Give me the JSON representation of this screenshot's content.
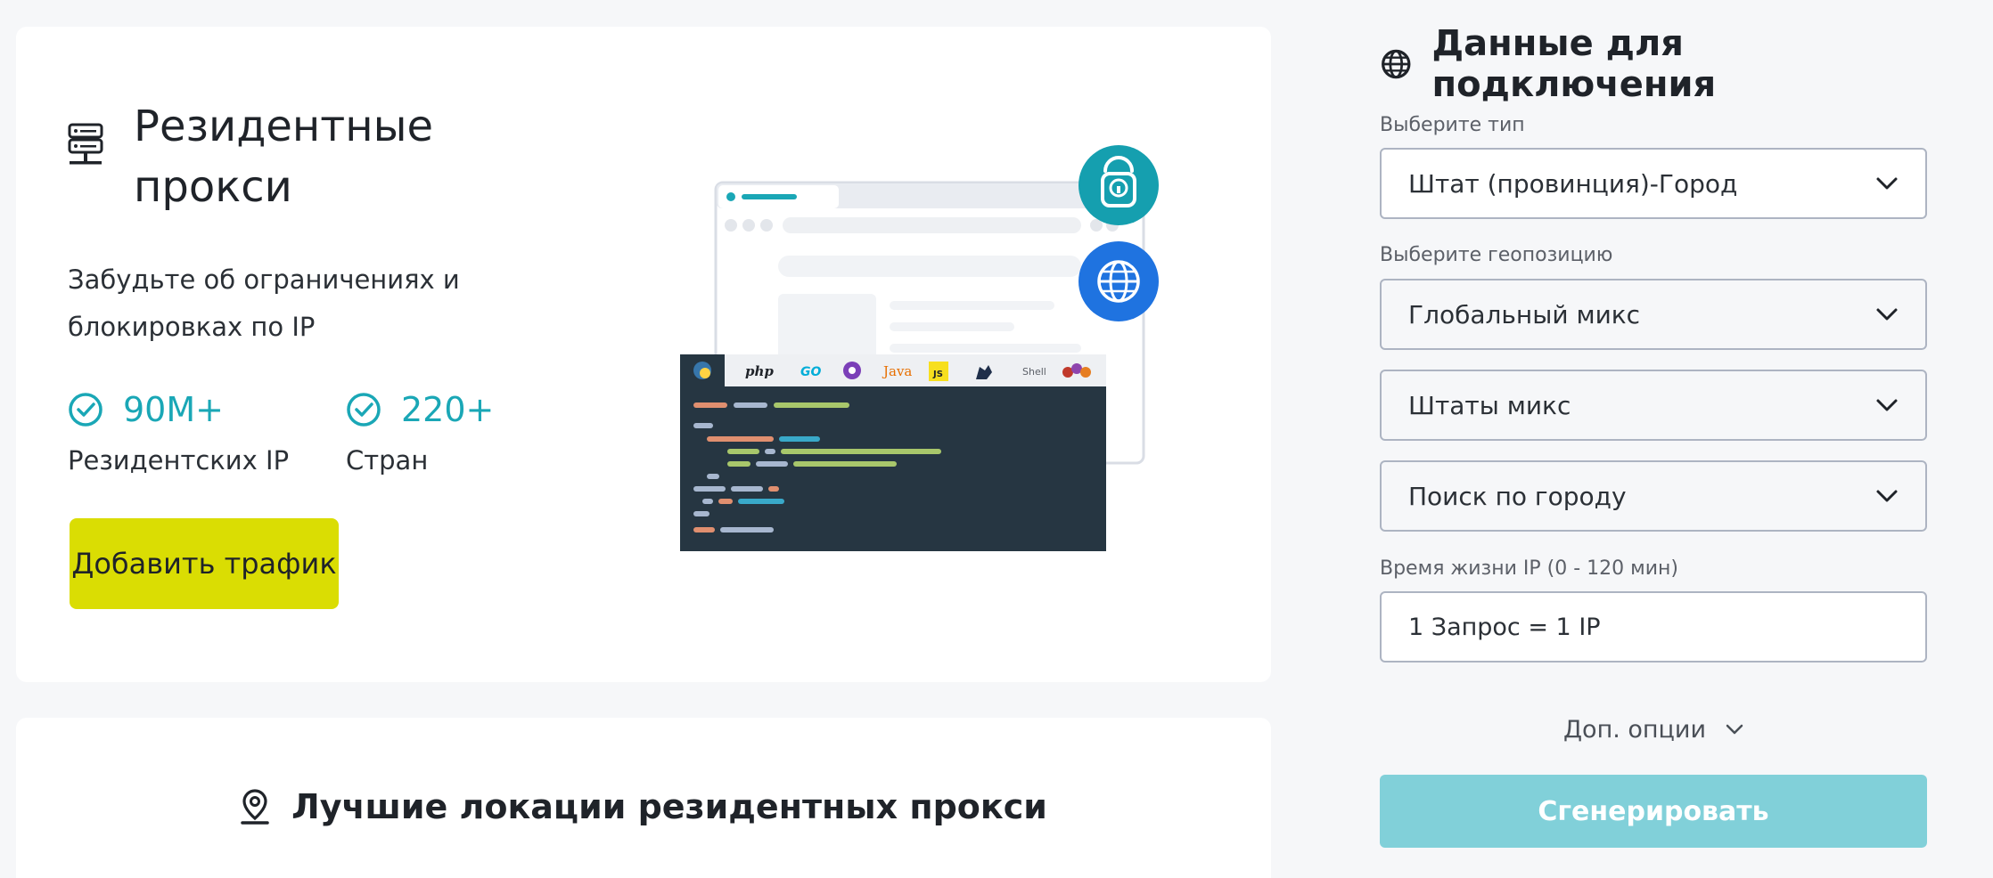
{
  "hero": {
    "title": "Резидентные прокси",
    "description": "Забудьте об ограничениях и блокировках по IP",
    "stats": [
      {
        "value": "90M+",
        "label": "Резидентских IP"
      },
      {
        "value": "220+",
        "label": "Стран"
      }
    ],
    "add_traffic_label": "Добавить трафик",
    "languages": [
      "php",
      "GO",
      "Java",
      "JS",
      "Shell"
    ]
  },
  "locations": {
    "title": "Лучшие локации резидентных прокси"
  },
  "panel": {
    "title": "Данные для подключения",
    "type_label": "Выберите тип",
    "type_value": "Штат (провинция)-Город",
    "geo_label": "Выберите геопозицию",
    "geo_value": "Глобальный микс",
    "state_value": "Штаты микс",
    "city_value": "Поиск по городу",
    "ttl_label": "Время жизни IP (0 - 120 мин)",
    "ttl_value": "1 Запрос = 1 IP",
    "more_options_label": "Доп. опции",
    "generate_label": "Сгенерировать"
  },
  "colors": {
    "accent": "#1aa7b6",
    "cta": "#dadd03",
    "generate": "#81d0d9",
    "code_bg": "#263642"
  },
  "icons": [
    "server-icon",
    "check-circle-icon",
    "lock-icon",
    "globe-icon",
    "location-pin-icon",
    "chevron-down-icon"
  ]
}
